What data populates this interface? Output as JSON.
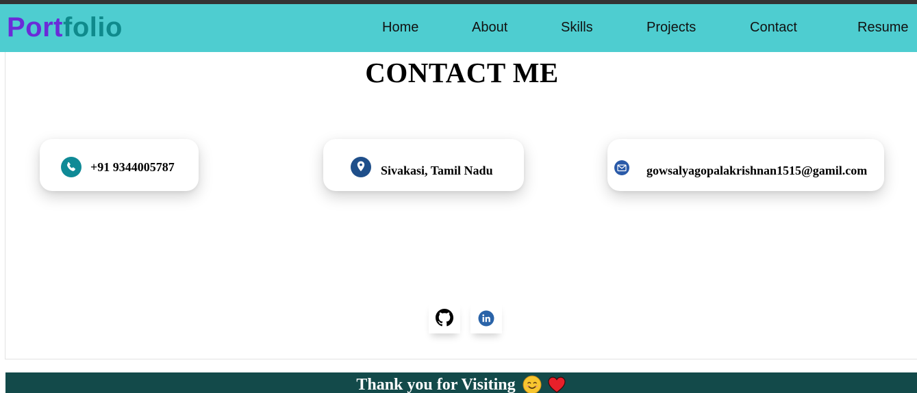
{
  "brand": {
    "part1": "Port",
    "part2": "folio"
  },
  "nav": {
    "home": "Home",
    "about": "About",
    "skills": "Skills",
    "projects": "Projects",
    "contact": "Contact",
    "resume": "Resume"
  },
  "contact": {
    "title": "CONTACT ME",
    "cards": [
      {
        "icon": "phone-icon",
        "text": "+91 9344005787"
      },
      {
        "icon": "location-pin-icon",
        "text": "Sivakasi, Tamil Nadu"
      },
      {
        "icon": "mail-icon",
        "text": "gowsalyagopalakrishnan1515@gamil.com"
      }
    ],
    "social": [
      {
        "icon": "github-icon"
      },
      {
        "icon": "linkedin-icon"
      }
    ]
  },
  "footer": {
    "text": "Thank you for Visiting",
    "emojis": [
      "smiling-face-icon",
      "heart-icon"
    ]
  },
  "colors": {
    "navbar": "#4ecdd0",
    "brand_part1": "#6b2bd8",
    "brand_part2": "#0f8a8c",
    "footer": "#134a4a",
    "phone_icon": "#0f8a96",
    "pin_icon": "#1f4f8a",
    "mail_icon": "#2a5aa8",
    "linkedin": "#2a63a8"
  }
}
